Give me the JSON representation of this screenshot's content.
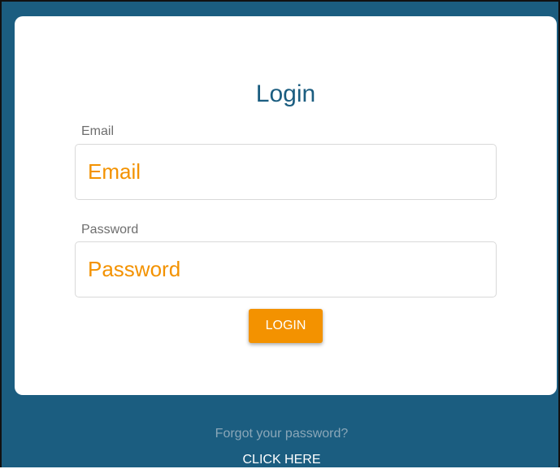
{
  "login_form": {
    "title": "Login",
    "email_label": "Email",
    "email_placeholder": "Email",
    "password_label": "Password",
    "password_placeholder": "Password",
    "login_button": "LOGIN"
  },
  "footer": {
    "forgot_text": "Forgot your password?",
    "click_here": "CLICK HERE"
  },
  "colors": {
    "background": "#1b5d80",
    "card": "#ffffff",
    "accent": "#f39200",
    "title": "#1b5d80",
    "muted_text": "#8aa7b8"
  }
}
